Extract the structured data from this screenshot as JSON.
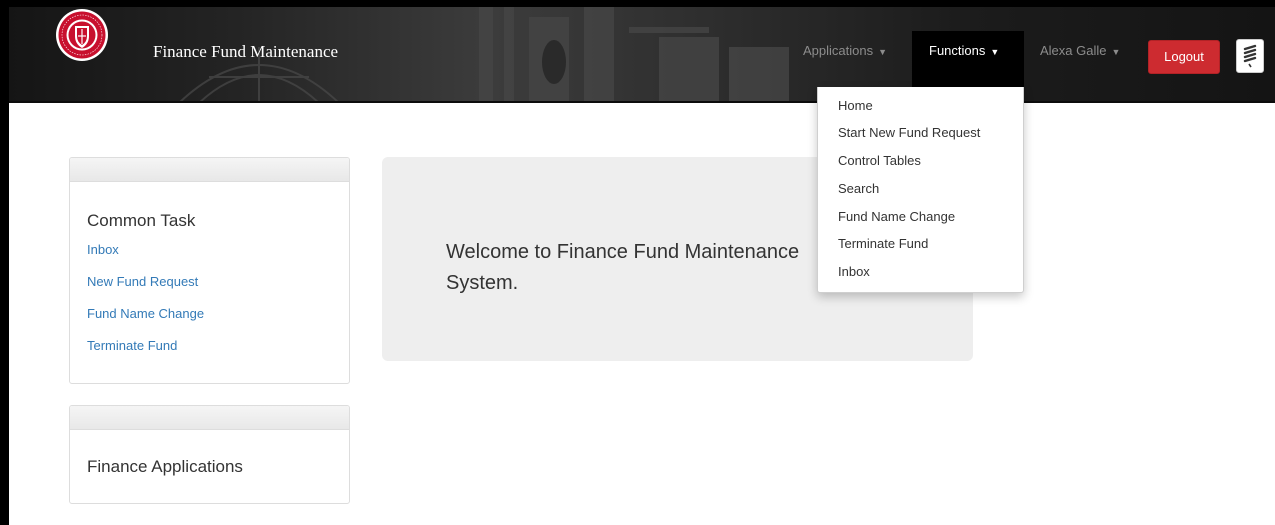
{
  "navbar": {
    "title": "Finance Fund Maintenance",
    "logo_icon": "texas-tech-university-system-seal",
    "applications_label": "Applications",
    "functions_label": "Functions",
    "user_label": "Alexa Galle",
    "logout_label": "Logout",
    "menu_icon": "hamburger-icon"
  },
  "functions_menu": {
    "items": [
      "Home",
      "Start New Fund Request",
      "Control Tables",
      "Search",
      "Fund Name Change",
      "Terminate Fund",
      "Inbox"
    ]
  },
  "common_task": {
    "title": "Common Task",
    "links": [
      "Inbox",
      "New Fund Request",
      "Fund Name Change",
      "Terminate Fund"
    ]
  },
  "finance_apps": {
    "title": "Finance Applications"
  },
  "welcome": {
    "text": "Welcome to Finance Fund Maintenance System."
  },
  "colors": {
    "navbar": "#222222",
    "logout": "#cd2b30",
    "link": "#337ab7",
    "jumbotron": "#eeeeee"
  }
}
